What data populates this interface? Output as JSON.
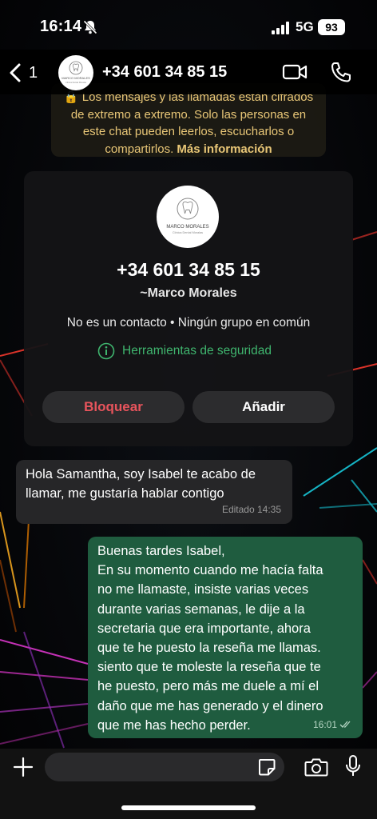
{
  "status_bar": {
    "time": "16:14",
    "network": "5G",
    "battery": "93"
  },
  "header": {
    "back_count": "1",
    "title": "+34 601 34 85 15",
    "avatar_logo_text": "MARCO MORALES",
    "avatar_logo_subtext": "Clínica Dental Moralas"
  },
  "encryption_notice": {
    "line1": "Los mensajes y las llamadas están cifrados",
    "line2": "de extremo a extremo. Solo las personas en",
    "line3": "este chat pueden leerlos, escucharlos o",
    "line4_prefix": "compartirlos.",
    "link": "Más información"
  },
  "contact_card": {
    "number": "+34 601 34 85 15",
    "name": "~Marco Morales",
    "info": "No es un contacto • Ningún grupo en común",
    "safety_tools": "Herramientas de seguridad",
    "block_label": "Bloquear",
    "add_label": "Añadir"
  },
  "messages": [
    {
      "direction": "incoming",
      "lines": [
        "Hola Samantha, soy Isabel te acabo de",
        "llamar, me gustaría hablar contigo"
      ],
      "meta": "Editado 14:35"
    },
    {
      "direction": "outgoing",
      "lines": [
        "Buenas tardes Isabel,",
        "En su momento cuando me hacía falta",
        "no me llamaste, insiste varias veces",
        "durante varias semanas, le dije a la",
        "secretaria que era importante, ahora",
        "que te he puesto la reseña me llamas.",
        "siento que te moleste la reseña que te",
        "he puesto, pero más me duele a mí el",
        "daño que me has generado y el dinero",
        "que me has hecho perder."
      ],
      "meta": "16:01",
      "read_status": "double-check-icon"
    }
  ],
  "composer": {
    "placeholder": ""
  },
  "colors": {
    "outgoing_bubble": "#1f5c3f",
    "incoming_bubble": "#262628",
    "accent_green": "#3fb56e",
    "danger": "#e8545c",
    "notice_text": "#e9c777"
  }
}
